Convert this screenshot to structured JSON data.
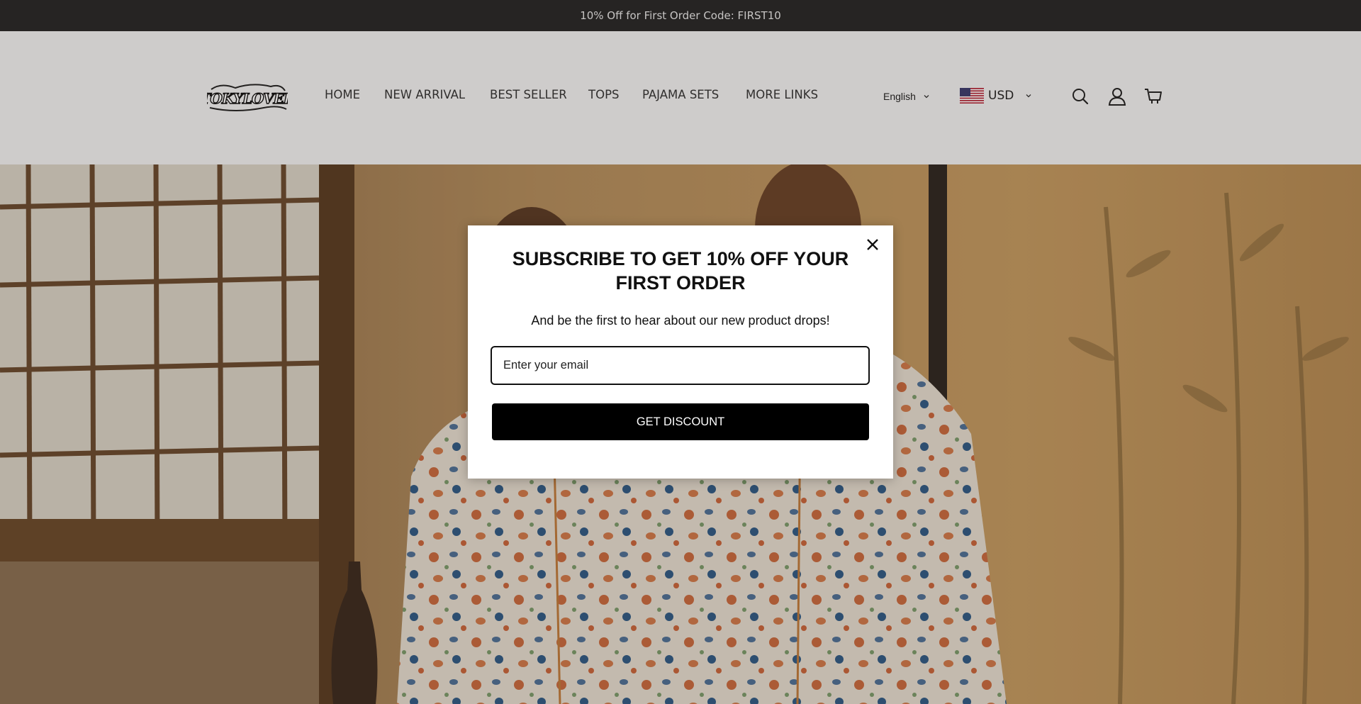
{
  "announcement": {
    "text": "10% Off for First Order Code: FIRST10"
  },
  "header": {
    "logo_text": "TOKYLOVER",
    "nav": [
      {
        "label": "HOME"
      },
      {
        "label": "NEW ARRIVAL"
      },
      {
        "label": "BEST SELLER"
      },
      {
        "label": "TOPS"
      },
      {
        "label": "PAJAMA SETS"
      },
      {
        "label": "MORE LINKS"
      }
    ],
    "language": {
      "value": "English",
      "icon": "chevron-down-icon"
    },
    "currency": {
      "value": "USD",
      "flag": "us-flag-icon",
      "icon": "chevron-down-icon"
    },
    "icons": [
      "search-icon",
      "account-icon",
      "cart-icon"
    ]
  },
  "popup": {
    "title": "SUBSCRIBE TO GET 10% OFF YOUR FIRST ORDER",
    "subtitle": "And be the first to hear about our new product drops!",
    "email_placeholder": "Enter your email",
    "button_label": "GET DISCOUNT",
    "close_icon": "close-icon"
  },
  "colors": {
    "announcement_bg": "#262626",
    "header_bg": "#f3f3f3",
    "button_bg": "#000000"
  }
}
